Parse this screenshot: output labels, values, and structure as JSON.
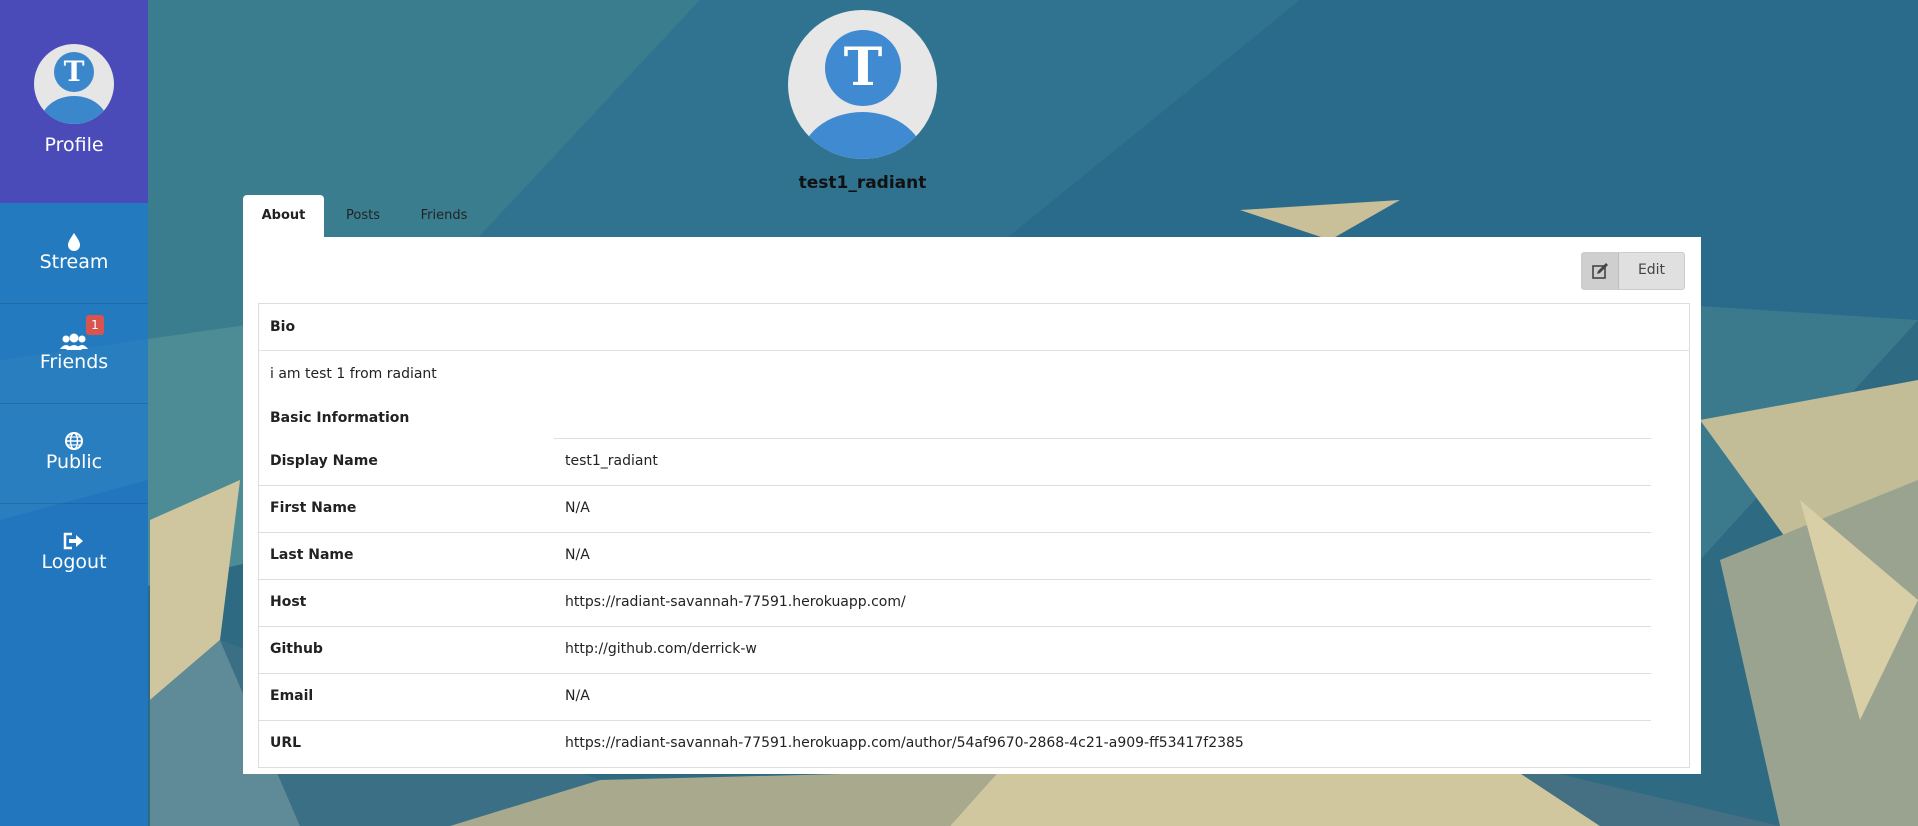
{
  "sidebar": {
    "profile_label": "Profile",
    "avatar_letter": "T",
    "items": [
      {
        "label": "Stream",
        "icon": "droplet-icon"
      },
      {
        "label": "Friends",
        "icon": "users-icon",
        "badge": "1"
      },
      {
        "label": "Public",
        "icon": "globe-icon"
      },
      {
        "label": "Logout",
        "icon": "sign-out-icon"
      }
    ]
  },
  "profile": {
    "avatar_letter": "T",
    "username": "test1_radiant"
  },
  "tabs": [
    {
      "label": "About",
      "active": true
    },
    {
      "label": "Posts",
      "active": false
    },
    {
      "label": "Friends",
      "active": false
    }
  ],
  "edit": {
    "label": "Edit",
    "icon": "edit-icon"
  },
  "about": {
    "bio_heading": "Bio",
    "bio_text": "i am test 1 from radiant",
    "basic_heading": "Basic Information",
    "rows": [
      {
        "key": "Display Name",
        "value": "test1_radiant"
      },
      {
        "key": "First Name",
        "value": "N/A"
      },
      {
        "key": "Last Name",
        "value": "N/A"
      },
      {
        "key": "Host",
        "value": "https://radiant-savannah-77591.herokuapp.com/"
      },
      {
        "key": "Github",
        "value": "http://github.com/derrick-w"
      },
      {
        "key": "Email",
        "value": "N/A"
      },
      {
        "key": "URL",
        "value": "https://radiant-savannah-77591.herokuapp.com/author/54af9670-2868-4c21-a909-ff53417f2385"
      }
    ]
  },
  "colors": {
    "sidebar_profile": "#4a4ab8",
    "sidebar": "#1f7acc",
    "avatar_blue": "#3f8ad0",
    "badge": "#d9534f"
  }
}
